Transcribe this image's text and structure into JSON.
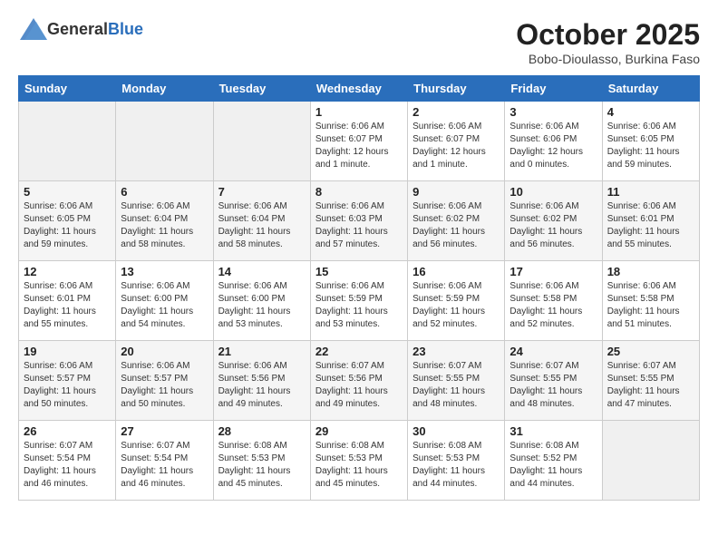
{
  "header": {
    "logo_general": "General",
    "logo_blue": "Blue",
    "month": "October 2025",
    "location": "Bobo-Dioulasso, Burkina Faso"
  },
  "days_of_week": [
    "Sunday",
    "Monday",
    "Tuesday",
    "Wednesday",
    "Thursday",
    "Friday",
    "Saturday"
  ],
  "weeks": [
    [
      {
        "day": "",
        "detail": ""
      },
      {
        "day": "",
        "detail": ""
      },
      {
        "day": "",
        "detail": ""
      },
      {
        "day": "1",
        "detail": "Sunrise: 6:06 AM\nSunset: 6:07 PM\nDaylight: 12 hours\nand 1 minute."
      },
      {
        "day": "2",
        "detail": "Sunrise: 6:06 AM\nSunset: 6:07 PM\nDaylight: 12 hours\nand 1 minute."
      },
      {
        "day": "3",
        "detail": "Sunrise: 6:06 AM\nSunset: 6:06 PM\nDaylight: 12 hours\nand 0 minutes."
      },
      {
        "day": "4",
        "detail": "Sunrise: 6:06 AM\nSunset: 6:05 PM\nDaylight: 11 hours\nand 59 minutes."
      }
    ],
    [
      {
        "day": "5",
        "detail": "Sunrise: 6:06 AM\nSunset: 6:05 PM\nDaylight: 11 hours\nand 59 minutes."
      },
      {
        "day": "6",
        "detail": "Sunrise: 6:06 AM\nSunset: 6:04 PM\nDaylight: 11 hours\nand 58 minutes."
      },
      {
        "day": "7",
        "detail": "Sunrise: 6:06 AM\nSunset: 6:04 PM\nDaylight: 11 hours\nand 58 minutes."
      },
      {
        "day": "8",
        "detail": "Sunrise: 6:06 AM\nSunset: 6:03 PM\nDaylight: 11 hours\nand 57 minutes."
      },
      {
        "day": "9",
        "detail": "Sunrise: 6:06 AM\nSunset: 6:02 PM\nDaylight: 11 hours\nand 56 minutes."
      },
      {
        "day": "10",
        "detail": "Sunrise: 6:06 AM\nSunset: 6:02 PM\nDaylight: 11 hours\nand 56 minutes."
      },
      {
        "day": "11",
        "detail": "Sunrise: 6:06 AM\nSunset: 6:01 PM\nDaylight: 11 hours\nand 55 minutes."
      }
    ],
    [
      {
        "day": "12",
        "detail": "Sunrise: 6:06 AM\nSunset: 6:01 PM\nDaylight: 11 hours\nand 55 minutes."
      },
      {
        "day": "13",
        "detail": "Sunrise: 6:06 AM\nSunset: 6:00 PM\nDaylight: 11 hours\nand 54 minutes."
      },
      {
        "day": "14",
        "detail": "Sunrise: 6:06 AM\nSunset: 6:00 PM\nDaylight: 11 hours\nand 53 minutes."
      },
      {
        "day": "15",
        "detail": "Sunrise: 6:06 AM\nSunset: 5:59 PM\nDaylight: 11 hours\nand 53 minutes."
      },
      {
        "day": "16",
        "detail": "Sunrise: 6:06 AM\nSunset: 5:59 PM\nDaylight: 11 hours\nand 52 minutes."
      },
      {
        "day": "17",
        "detail": "Sunrise: 6:06 AM\nSunset: 5:58 PM\nDaylight: 11 hours\nand 52 minutes."
      },
      {
        "day": "18",
        "detail": "Sunrise: 6:06 AM\nSunset: 5:58 PM\nDaylight: 11 hours\nand 51 minutes."
      }
    ],
    [
      {
        "day": "19",
        "detail": "Sunrise: 6:06 AM\nSunset: 5:57 PM\nDaylight: 11 hours\nand 50 minutes."
      },
      {
        "day": "20",
        "detail": "Sunrise: 6:06 AM\nSunset: 5:57 PM\nDaylight: 11 hours\nand 50 minutes."
      },
      {
        "day": "21",
        "detail": "Sunrise: 6:06 AM\nSunset: 5:56 PM\nDaylight: 11 hours\nand 49 minutes."
      },
      {
        "day": "22",
        "detail": "Sunrise: 6:07 AM\nSunset: 5:56 PM\nDaylight: 11 hours\nand 49 minutes."
      },
      {
        "day": "23",
        "detail": "Sunrise: 6:07 AM\nSunset: 5:55 PM\nDaylight: 11 hours\nand 48 minutes."
      },
      {
        "day": "24",
        "detail": "Sunrise: 6:07 AM\nSunset: 5:55 PM\nDaylight: 11 hours\nand 48 minutes."
      },
      {
        "day": "25",
        "detail": "Sunrise: 6:07 AM\nSunset: 5:55 PM\nDaylight: 11 hours\nand 47 minutes."
      }
    ],
    [
      {
        "day": "26",
        "detail": "Sunrise: 6:07 AM\nSunset: 5:54 PM\nDaylight: 11 hours\nand 46 minutes."
      },
      {
        "day": "27",
        "detail": "Sunrise: 6:07 AM\nSunset: 5:54 PM\nDaylight: 11 hours\nand 46 minutes."
      },
      {
        "day": "28",
        "detail": "Sunrise: 6:08 AM\nSunset: 5:53 PM\nDaylight: 11 hours\nand 45 minutes."
      },
      {
        "day": "29",
        "detail": "Sunrise: 6:08 AM\nSunset: 5:53 PM\nDaylight: 11 hours\nand 45 minutes."
      },
      {
        "day": "30",
        "detail": "Sunrise: 6:08 AM\nSunset: 5:53 PM\nDaylight: 11 hours\nand 44 minutes."
      },
      {
        "day": "31",
        "detail": "Sunrise: 6:08 AM\nSunset: 5:52 PM\nDaylight: 11 hours\nand 44 minutes."
      },
      {
        "day": "",
        "detail": ""
      }
    ]
  ]
}
